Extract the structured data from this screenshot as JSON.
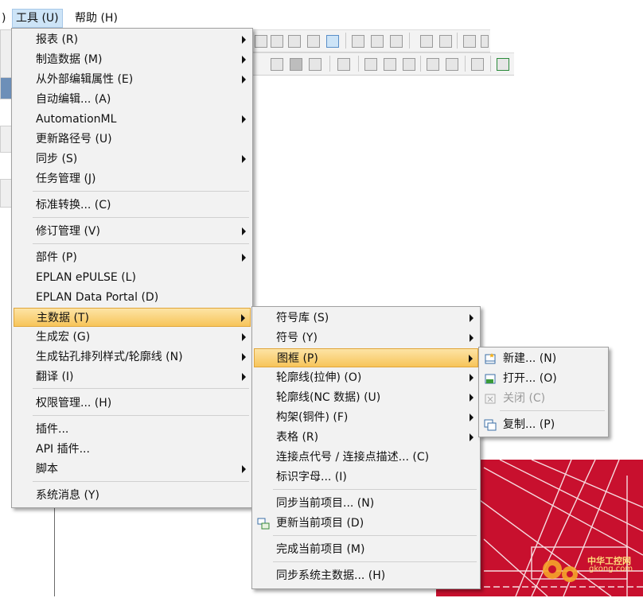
{
  "menubar": {
    "partial_left": ")",
    "tools": "工具 (U)",
    "help": "帮助 (H)"
  },
  "tools_menu": {
    "items": [
      {
        "label": "报表 (R)",
        "submenu": true
      },
      {
        "label": "制造数据 (M)",
        "submenu": true
      },
      {
        "label": "从外部编辑属性 (E)",
        "submenu": true
      },
      {
        "label": "自动编辑... (A)",
        "submenu": false
      },
      {
        "label": "AutomationML",
        "submenu": true
      },
      {
        "label": "更新路径号 (U)",
        "submenu": false
      },
      {
        "label": "同步 (S)",
        "submenu": true
      },
      {
        "label": "任务管理 (J)",
        "submenu": false
      },
      {
        "label": "标准转换... (C)",
        "submenu": false
      },
      {
        "label": "修订管理 (V)",
        "submenu": true
      },
      {
        "label": "部件 (P)",
        "submenu": true
      },
      {
        "label": "EPLAN ePULSE (L)",
        "submenu": false
      },
      {
        "label": "EPLAN Data Portal (D)",
        "submenu": false
      },
      {
        "label": "主数据 (T)",
        "submenu": true
      },
      {
        "label": "生成宏 (G)",
        "submenu": true
      },
      {
        "label": "生成钻孔排列样式/轮廓线 (N)",
        "submenu": true
      },
      {
        "label": "翻译 (I)",
        "submenu": true
      },
      {
        "label": "权限管理... (H)",
        "submenu": false
      },
      {
        "label": "插件...",
        "submenu": false
      },
      {
        "label": "API 插件...",
        "submenu": false
      },
      {
        "label": "脚本",
        "submenu": true
      },
      {
        "label": "系统消息 (Y)",
        "submenu": false
      }
    ]
  },
  "masterdata_menu": {
    "items": [
      {
        "label": "符号库 (S)",
        "submenu": true
      },
      {
        "label": "符号 (Y)",
        "submenu": true
      },
      {
        "label": "图框 (P)",
        "submenu": true
      },
      {
        "label": "轮廓线(拉伸) (O)",
        "submenu": true
      },
      {
        "label": "轮廓线(NC 数据) (U)",
        "submenu": true
      },
      {
        "label": "构架(铜件) (F)",
        "submenu": true
      },
      {
        "label": "表格 (R)",
        "submenu": true
      },
      {
        "label": "连接点代号 / 连接点描述... (C)",
        "submenu": false
      },
      {
        "label": "标识字母... (I)",
        "submenu": false
      },
      {
        "label": "同步当前项目... (N)",
        "submenu": false
      },
      {
        "label": "更新当前项目 (D)",
        "submenu": false
      },
      {
        "label": "完成当前项目 (M)",
        "submenu": false
      },
      {
        "label": "同步系统主数据... (H)",
        "submenu": false
      }
    ]
  },
  "frame_menu": {
    "items": [
      {
        "label": "新建... (N)",
        "enabled": true,
        "icon": "new-frame-icon"
      },
      {
        "label": "打开... (O)",
        "enabled": true,
        "icon": "open-frame-icon"
      },
      {
        "label": "关闭 (C)",
        "enabled": false,
        "icon": "close-frame-icon"
      },
      {
        "label": "复制... (P)",
        "enabled": true,
        "icon": "copy-frame-icon"
      }
    ]
  },
  "colors": {
    "highlight": "#f7c55a",
    "menu_bg": "#f2f2f2",
    "drawing_red": "#c8102e"
  },
  "watermark": {
    "text": "中华工控网",
    "url": "gkong.com"
  }
}
